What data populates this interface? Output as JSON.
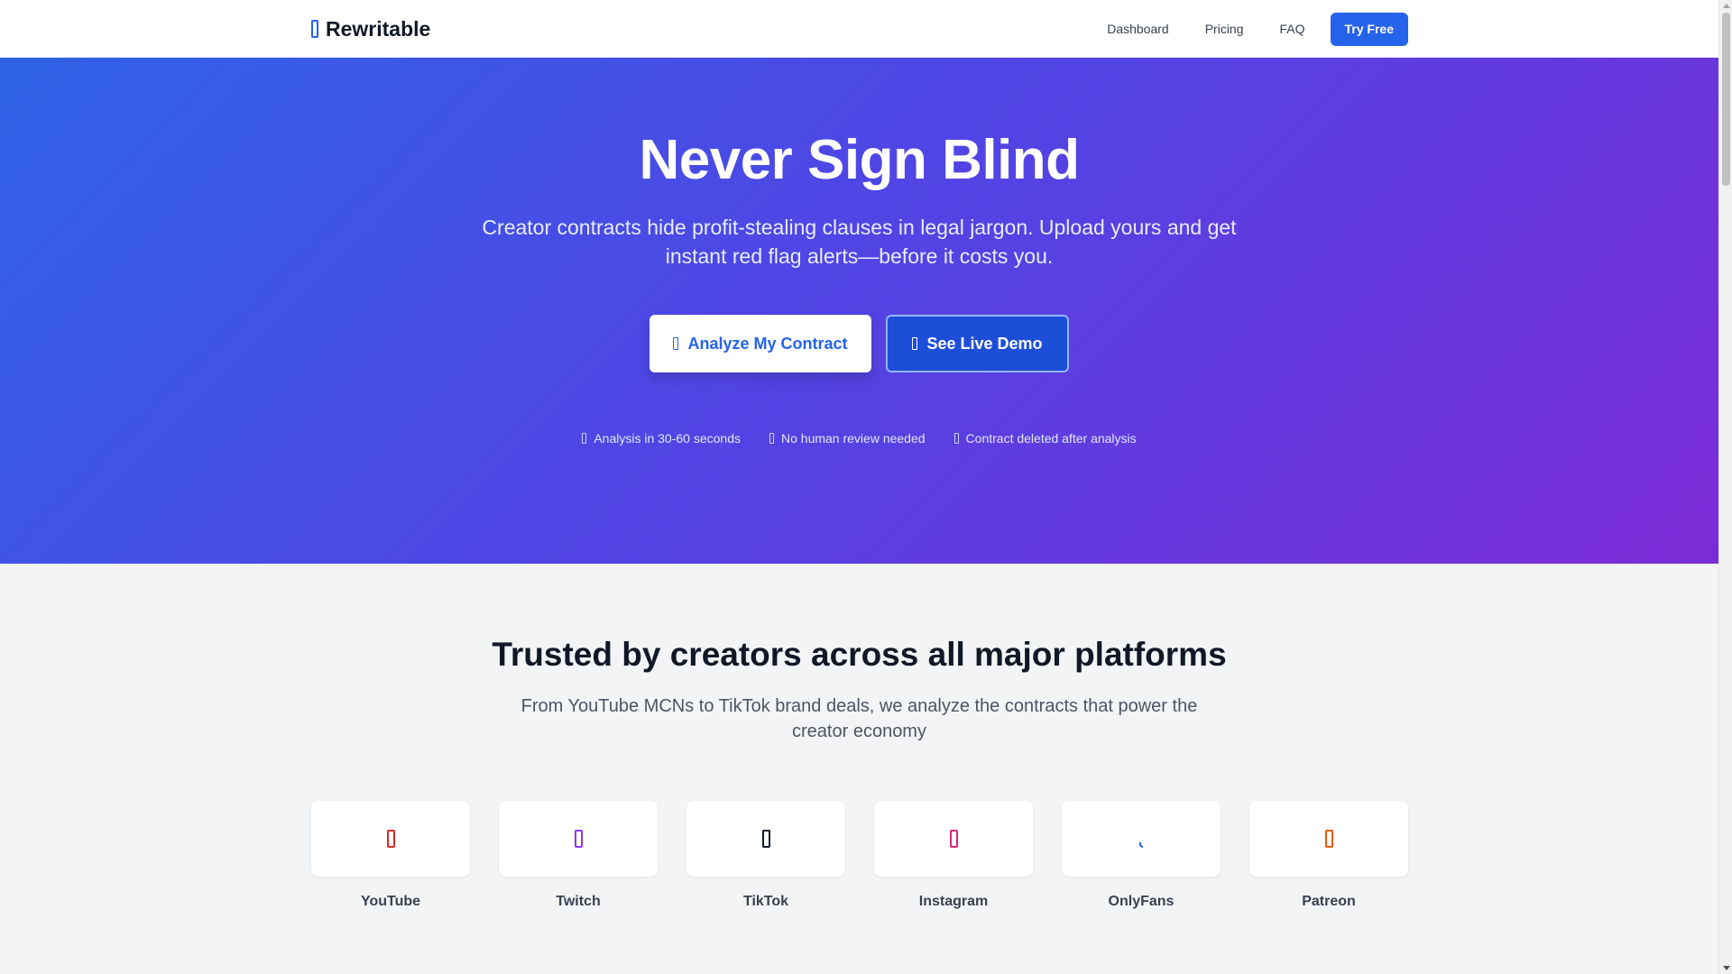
{
  "nav": {
    "brand": "Rewritable",
    "brand_icon": "document-icon",
    "links": [
      "Dashboard",
      "Pricing",
      "FAQ"
    ],
    "cta": "Try Free",
    "accent": "#2563eb"
  },
  "hero": {
    "title": "Never Sign Blind",
    "subtitle": "Creator contracts hide profit-stealing clauses in legal jargon. Upload yours and get instant red flag alerts—before it costs you.",
    "primary_button": "Analyze My Contract",
    "primary_icon": "upload-icon",
    "secondary_button": "See Live Demo",
    "secondary_icon": "play-icon",
    "features": [
      {
        "icon": "clock-icon",
        "text": "Analysis in 30-60 seconds"
      },
      {
        "icon": "robot-icon",
        "text": "No human review needed"
      },
      {
        "icon": "trash-icon",
        "text": "Contract deleted after analysis"
      }
    ],
    "gradient": [
      "#2f63e6",
      "#4f46e5",
      "#7c2bd6"
    ]
  },
  "platforms_section": {
    "title": "Trusted by creators across all major platforms",
    "subtitle": "From YouTube MCNs to TikTok brand deals, we analyze the contracts that power the creator economy",
    "items": [
      {
        "name": "YouTube",
        "icon": "youtube-icon",
        "color": "#dc2626"
      },
      {
        "name": "Twitch",
        "icon": "twitch-icon",
        "color": "#9333ea"
      },
      {
        "name": "TikTok",
        "icon": "tiktok-icon",
        "color": "#111827"
      },
      {
        "name": "Instagram",
        "icon": "instagram-icon",
        "color": "#db2777"
      },
      {
        "name": "OnlyFans",
        "icon": "onlyfans-icon",
        "color": "#2563eb"
      },
      {
        "name": "Patreon",
        "icon": "patreon-icon",
        "color": "#ea580c"
      }
    ]
  }
}
